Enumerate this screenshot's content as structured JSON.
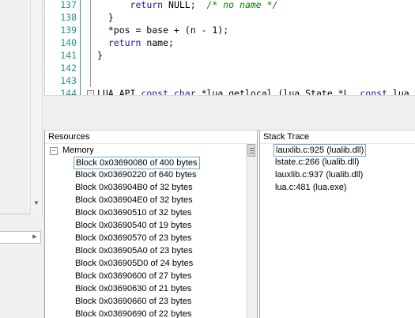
{
  "editor": {
    "lines": [
      {
        "n": "137",
        "parts": [
          {
            "t": "      ",
            "c": ""
          },
          {
            "t": "return",
            "c": "kw"
          },
          {
            "t": " NULL;  ",
            "c": ""
          },
          {
            "t": "/* no name */",
            "c": "cm"
          }
        ]
      },
      {
        "n": "138",
        "parts": [
          {
            "t": "  }",
            "c": ""
          }
        ]
      },
      {
        "n": "139",
        "parts": [
          {
            "t": "  *pos = base + (n - 1);",
            "c": ""
          }
        ]
      },
      {
        "n": "140",
        "parts": [
          {
            "t": "  ",
            "c": ""
          },
          {
            "t": "return",
            "c": "kw"
          },
          {
            "t": " name;",
            "c": ""
          }
        ]
      },
      {
        "n": "141",
        "parts": [
          {
            "t": "}",
            "c": ""
          }
        ]
      },
      {
        "n": "142",
        "parts": []
      },
      {
        "n": "143",
        "parts": []
      },
      {
        "n": "144",
        "parts": [
          {
            "t": "LUA_API ",
            "c": ""
          },
          {
            "t": "const",
            "c": "kw"
          },
          {
            "t": " ",
            "c": ""
          },
          {
            "t": "char",
            "c": "kw"
          },
          {
            "t": " *lua_getlocal (lua_State *L, ",
            "c": ""
          },
          {
            "t": "const",
            "c": "kw"
          },
          {
            "t": " lua_De",
            "c": ""
          }
        ]
      }
    ]
  },
  "resources": {
    "header": "Resources",
    "group": {
      "toggle": "−",
      "label": "Memory"
    },
    "blocks": [
      "Block 0x03690080 of 400 bytes",
      "Block 0x03690220 of 640 bytes",
      "Block 0x036904B0 of 32 bytes",
      "Block 0x036904E0 of 32 bytes",
      "Block 0x03690510 of 32 bytes",
      "Block 0x03690540 of 19 bytes",
      "Block 0x03690570 of 23 bytes",
      "Block 0x036905A0 of 23 bytes",
      "Block 0x036905D0 of 24 bytes",
      "Block 0x03690600 of 27 bytes",
      "Block 0x03690630 of 21 bytes",
      "Block 0x03690660 of 23 bytes",
      "Block 0x03690690 of 22 bytes"
    ],
    "selected_index": 0
  },
  "stack_trace": {
    "header": "Stack Trace",
    "frames": [
      "lauxlib.c:925 (lualib.dll)",
      "lstate.c:266 (lualib.dll)",
      "lauxlib.c:937 (lualib.dll)",
      "lua.c:481 (lua.exe)"
    ],
    "selected_index": 0
  },
  "colors": {
    "keyword": "#1a1aa6",
    "comment": "#008000",
    "line_number": "#2b8f8f",
    "selection_border": "#6aa6d6"
  }
}
